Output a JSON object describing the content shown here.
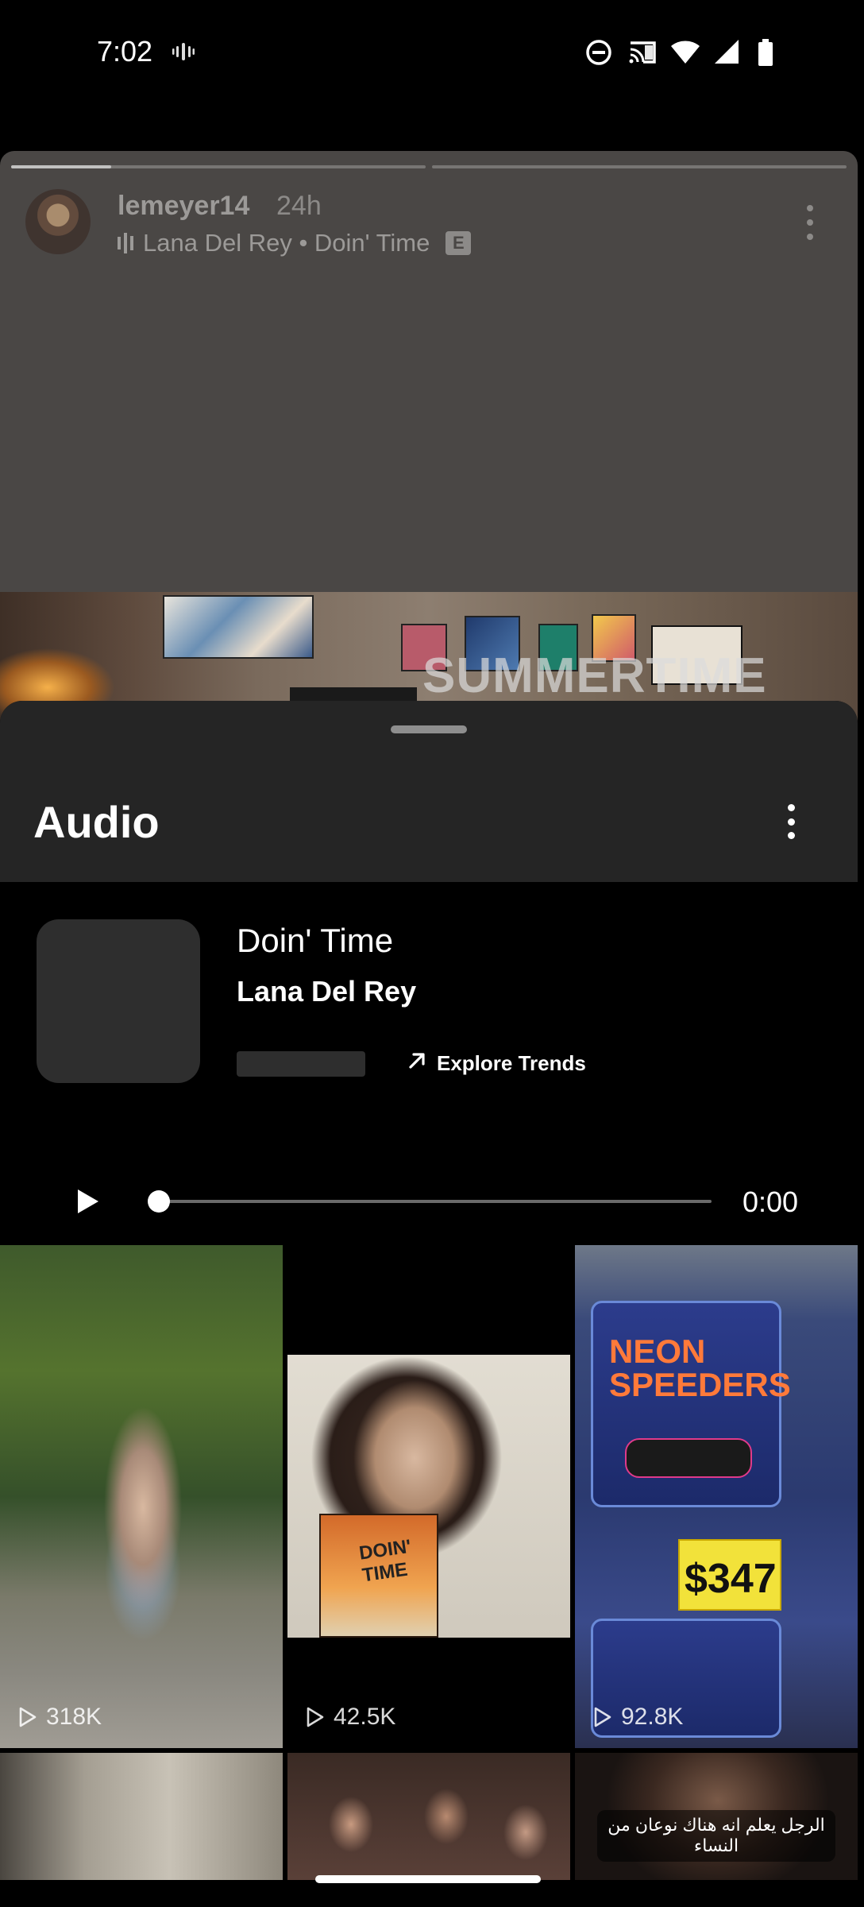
{
  "status_bar": {
    "time": "7:02",
    "icons": [
      "vibrate-icon",
      "do-not-disturb-icon",
      "cast-icon",
      "wifi-icon",
      "signal-icon",
      "battery-icon"
    ]
  },
  "story": {
    "username": "lemeyer14",
    "age": "24h",
    "music_text": "Lana Del Rey • Doin' Time",
    "explicit_badge": "E",
    "overlay_text": "SUMMERTIME",
    "progress_segments": 2
  },
  "sheet": {
    "title": "Audio",
    "track_title": "Doin' Time",
    "artist": "Lana Del Rey",
    "explore_label": "Explore Trends",
    "time": "0:00",
    "playback_progress": 0
  },
  "grid": {
    "tiles": [
      {
        "count": "318K"
      },
      {
        "count": "42.5K",
        "cover_text": "DOIN' TIME"
      },
      {
        "count": "92.8K",
        "brand_text": "NEON SPEEDERS",
        "price": "$347"
      },
      {
        "count": ""
      },
      {
        "count": ""
      },
      {
        "count": "",
        "caption": "الرجل يعلم انه هناك نوعان من النساء"
      }
    ]
  },
  "colors": {
    "sheet_header": "#252525",
    "background": "#000000",
    "story_dim": "#4a4745"
  }
}
